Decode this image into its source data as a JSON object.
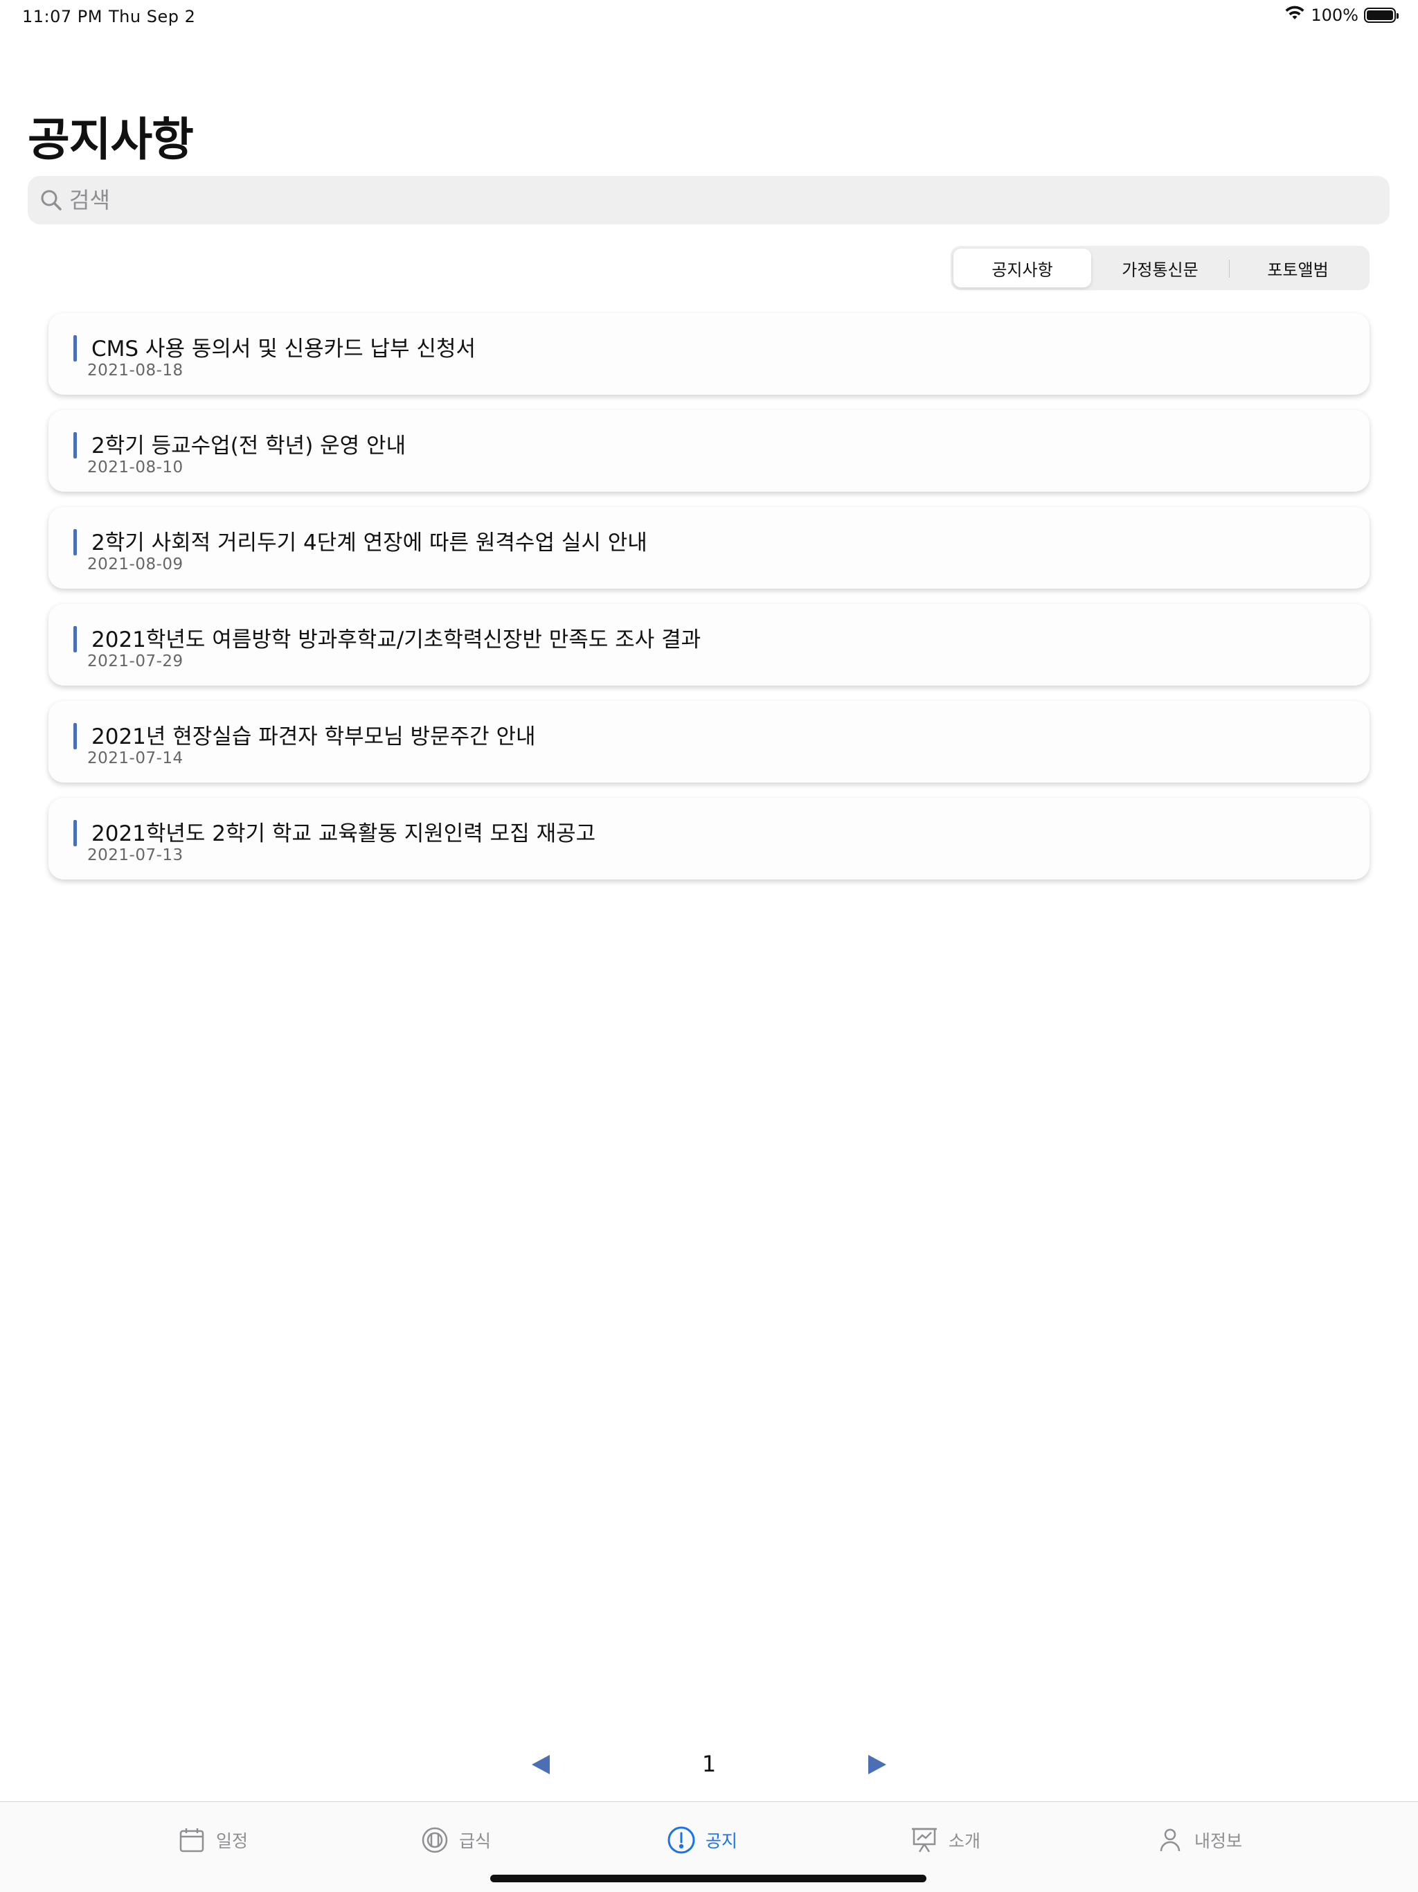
{
  "status_bar": {
    "time": "11:07 PM",
    "date": "Thu Sep 2",
    "battery": "100%"
  },
  "page_title": "공지사항",
  "search": {
    "placeholder": "검색",
    "value": ""
  },
  "segments": [
    {
      "label": "공지사항",
      "selected": true
    },
    {
      "label": "가정통신문",
      "selected": false
    },
    {
      "label": "포토앨범",
      "selected": false
    }
  ],
  "notices": [
    {
      "title": "CMS 사용 동의서 및 신용카드 납부 신청서",
      "date": "2021-08-18"
    },
    {
      "title": "2학기 등교수업(전 학년) 운영 안내",
      "date": "2021-08-10"
    },
    {
      "title": "2학기 사회적 거리두기 4단계 연장에 따른 원격수업 실시 안내",
      "date": "2021-08-09"
    },
    {
      "title": "2021학년도 여름방학 방과후학교/기초학력신장반 만족도 조사 결과",
      "date": "2021-07-29"
    },
    {
      "title": "2021년 현장실습 파견자 학부모님 방문주간 안내",
      "date": "2021-07-14"
    },
    {
      "title": "2021학년도 2학기 학교 교육활동 지원인력 모집 재공고",
      "date": "2021-07-13"
    }
  ],
  "pagination": {
    "current_page": "1"
  },
  "tab_bar": {
    "tabs": [
      {
        "label": "일정",
        "icon": "calendar-icon"
      },
      {
        "label": "급식",
        "icon": "meal-icon"
      },
      {
        "label": "공지",
        "icon": "exclamation-circle-icon"
      },
      {
        "label": "소개",
        "icon": "presentation-icon"
      },
      {
        "label": "내정보",
        "icon": "person-icon"
      }
    ],
    "active": "공지"
  },
  "colors": {
    "accent": "#1a73e8",
    "notice_bar": "#4a6fb5",
    "inactive_tab": "#8e8e93"
  }
}
